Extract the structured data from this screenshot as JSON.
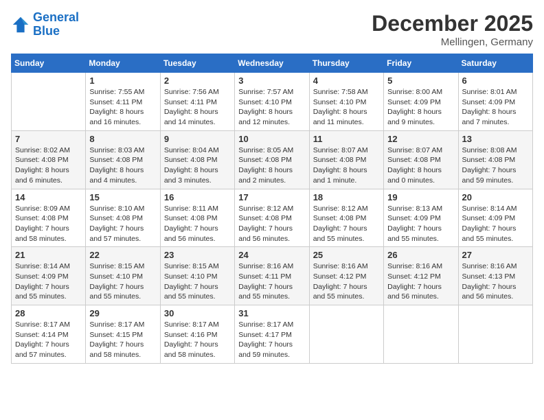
{
  "header": {
    "logo_line1": "General",
    "logo_line2": "Blue",
    "month_year": "December 2025",
    "location": "Mellingen, Germany"
  },
  "days_of_week": [
    "Sunday",
    "Monday",
    "Tuesday",
    "Wednesday",
    "Thursday",
    "Friday",
    "Saturday"
  ],
  "weeks": [
    [
      {
        "day": "",
        "info": ""
      },
      {
        "day": "1",
        "info": "Sunrise: 7:55 AM\nSunset: 4:11 PM\nDaylight: 8 hours\nand 16 minutes."
      },
      {
        "day": "2",
        "info": "Sunrise: 7:56 AM\nSunset: 4:11 PM\nDaylight: 8 hours\nand 14 minutes."
      },
      {
        "day": "3",
        "info": "Sunrise: 7:57 AM\nSunset: 4:10 PM\nDaylight: 8 hours\nand 12 minutes."
      },
      {
        "day": "4",
        "info": "Sunrise: 7:58 AM\nSunset: 4:10 PM\nDaylight: 8 hours\nand 11 minutes."
      },
      {
        "day": "5",
        "info": "Sunrise: 8:00 AM\nSunset: 4:09 PM\nDaylight: 8 hours\nand 9 minutes."
      },
      {
        "day": "6",
        "info": "Sunrise: 8:01 AM\nSunset: 4:09 PM\nDaylight: 8 hours\nand 7 minutes."
      }
    ],
    [
      {
        "day": "7",
        "info": "Sunrise: 8:02 AM\nSunset: 4:08 PM\nDaylight: 8 hours\nand 6 minutes."
      },
      {
        "day": "8",
        "info": "Sunrise: 8:03 AM\nSunset: 4:08 PM\nDaylight: 8 hours\nand 4 minutes."
      },
      {
        "day": "9",
        "info": "Sunrise: 8:04 AM\nSunset: 4:08 PM\nDaylight: 8 hours\nand 3 minutes."
      },
      {
        "day": "10",
        "info": "Sunrise: 8:05 AM\nSunset: 4:08 PM\nDaylight: 8 hours\nand 2 minutes."
      },
      {
        "day": "11",
        "info": "Sunrise: 8:07 AM\nSunset: 4:08 PM\nDaylight: 8 hours\nand 1 minute."
      },
      {
        "day": "12",
        "info": "Sunrise: 8:07 AM\nSunset: 4:08 PM\nDaylight: 8 hours\nand 0 minutes."
      },
      {
        "day": "13",
        "info": "Sunrise: 8:08 AM\nSunset: 4:08 PM\nDaylight: 7 hours\nand 59 minutes."
      }
    ],
    [
      {
        "day": "14",
        "info": "Sunrise: 8:09 AM\nSunset: 4:08 PM\nDaylight: 7 hours\nand 58 minutes."
      },
      {
        "day": "15",
        "info": "Sunrise: 8:10 AM\nSunset: 4:08 PM\nDaylight: 7 hours\nand 57 minutes."
      },
      {
        "day": "16",
        "info": "Sunrise: 8:11 AM\nSunset: 4:08 PM\nDaylight: 7 hours\nand 56 minutes."
      },
      {
        "day": "17",
        "info": "Sunrise: 8:12 AM\nSunset: 4:08 PM\nDaylight: 7 hours\nand 56 minutes."
      },
      {
        "day": "18",
        "info": "Sunrise: 8:12 AM\nSunset: 4:08 PM\nDaylight: 7 hours\nand 55 minutes."
      },
      {
        "day": "19",
        "info": "Sunrise: 8:13 AM\nSunset: 4:09 PM\nDaylight: 7 hours\nand 55 minutes."
      },
      {
        "day": "20",
        "info": "Sunrise: 8:14 AM\nSunset: 4:09 PM\nDaylight: 7 hours\nand 55 minutes."
      }
    ],
    [
      {
        "day": "21",
        "info": "Sunrise: 8:14 AM\nSunset: 4:09 PM\nDaylight: 7 hours\nand 55 minutes."
      },
      {
        "day": "22",
        "info": "Sunrise: 8:15 AM\nSunset: 4:10 PM\nDaylight: 7 hours\nand 55 minutes."
      },
      {
        "day": "23",
        "info": "Sunrise: 8:15 AM\nSunset: 4:10 PM\nDaylight: 7 hours\nand 55 minutes."
      },
      {
        "day": "24",
        "info": "Sunrise: 8:16 AM\nSunset: 4:11 PM\nDaylight: 7 hours\nand 55 minutes."
      },
      {
        "day": "25",
        "info": "Sunrise: 8:16 AM\nSunset: 4:12 PM\nDaylight: 7 hours\nand 55 minutes."
      },
      {
        "day": "26",
        "info": "Sunrise: 8:16 AM\nSunset: 4:12 PM\nDaylight: 7 hours\nand 56 minutes."
      },
      {
        "day": "27",
        "info": "Sunrise: 8:16 AM\nSunset: 4:13 PM\nDaylight: 7 hours\nand 56 minutes."
      }
    ],
    [
      {
        "day": "28",
        "info": "Sunrise: 8:17 AM\nSunset: 4:14 PM\nDaylight: 7 hours\nand 57 minutes."
      },
      {
        "day": "29",
        "info": "Sunrise: 8:17 AM\nSunset: 4:15 PM\nDaylight: 7 hours\nand 58 minutes."
      },
      {
        "day": "30",
        "info": "Sunrise: 8:17 AM\nSunset: 4:16 PM\nDaylight: 7 hours\nand 58 minutes."
      },
      {
        "day": "31",
        "info": "Sunrise: 8:17 AM\nSunset: 4:17 PM\nDaylight: 7 hours\nand 59 minutes."
      },
      {
        "day": "",
        "info": ""
      },
      {
        "day": "",
        "info": ""
      },
      {
        "day": "",
        "info": ""
      }
    ]
  ]
}
